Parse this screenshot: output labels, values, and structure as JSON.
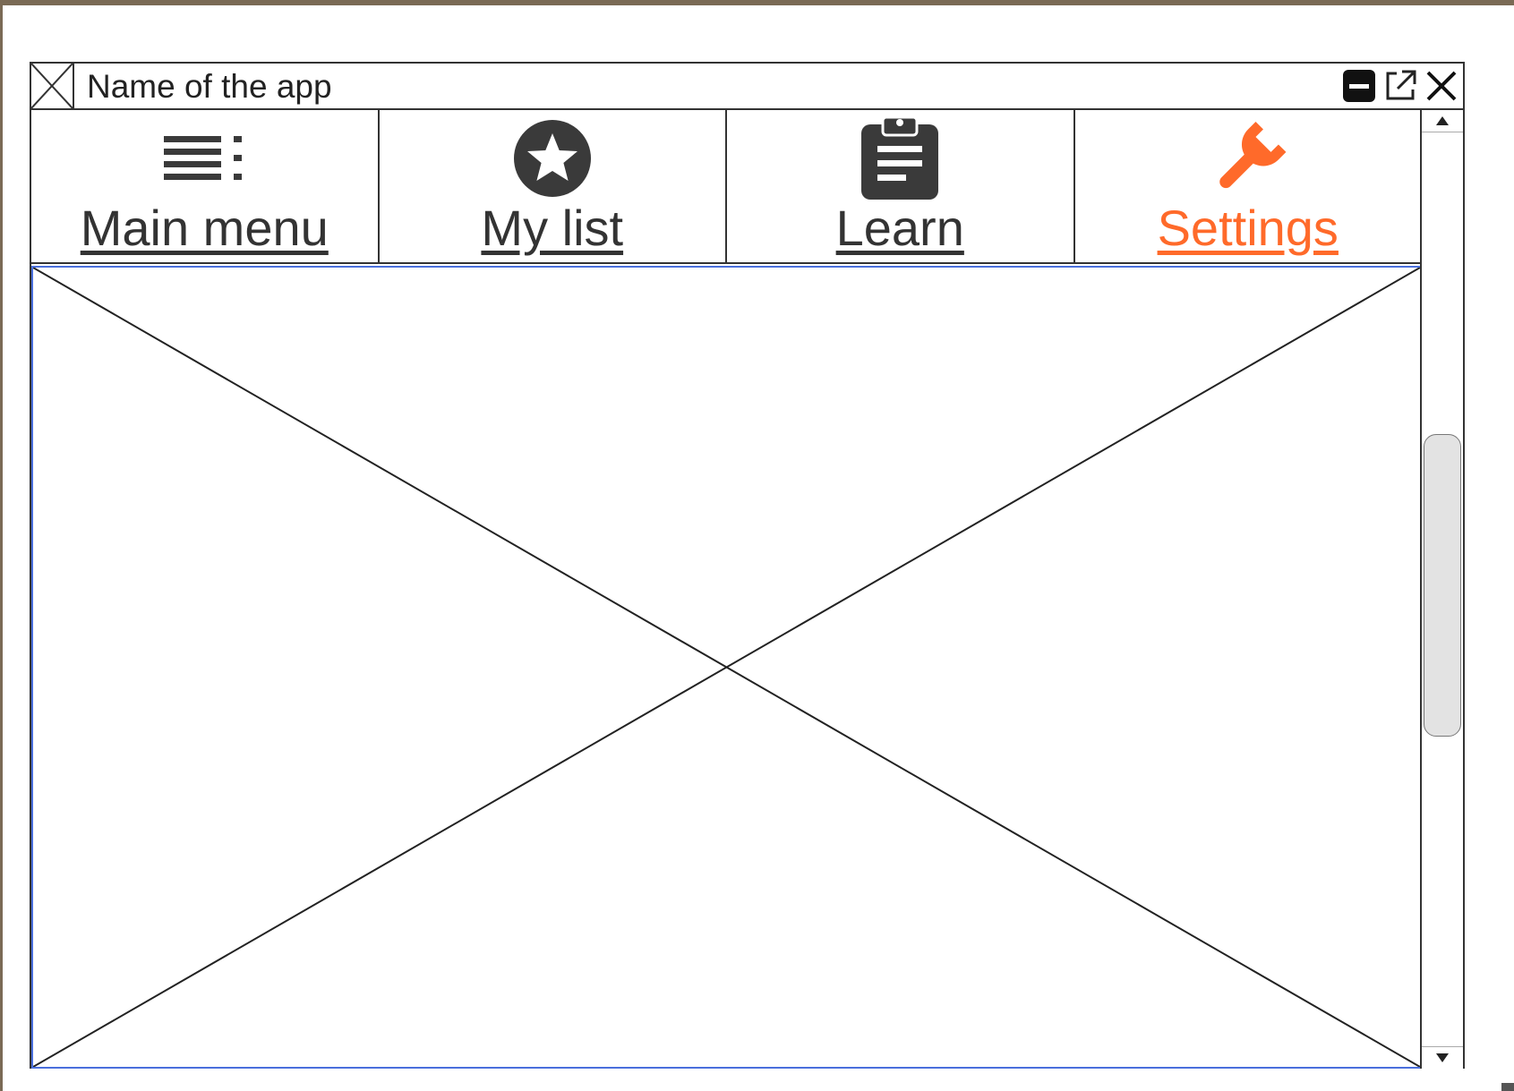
{
  "window": {
    "title": "Name of the app",
    "controls": [
      "minimize-icon",
      "popout-icon",
      "close-icon"
    ]
  },
  "nav": {
    "items": [
      {
        "label": "Main menu",
        "icon": "list-menu-icon",
        "active": false
      },
      {
        "label": "My list",
        "icon": "star-circle-icon",
        "active": false
      },
      {
        "label": "Learn",
        "icon": "clipboard-icon",
        "active": false
      },
      {
        "label": "Settings",
        "icon": "wrench-icon",
        "active": true
      }
    ]
  },
  "content": {
    "type": "image-placeholder"
  },
  "colors": {
    "accent": "#ff6a2a",
    "icon": "#3a3a3a",
    "content_border": "#4a6fdc"
  }
}
